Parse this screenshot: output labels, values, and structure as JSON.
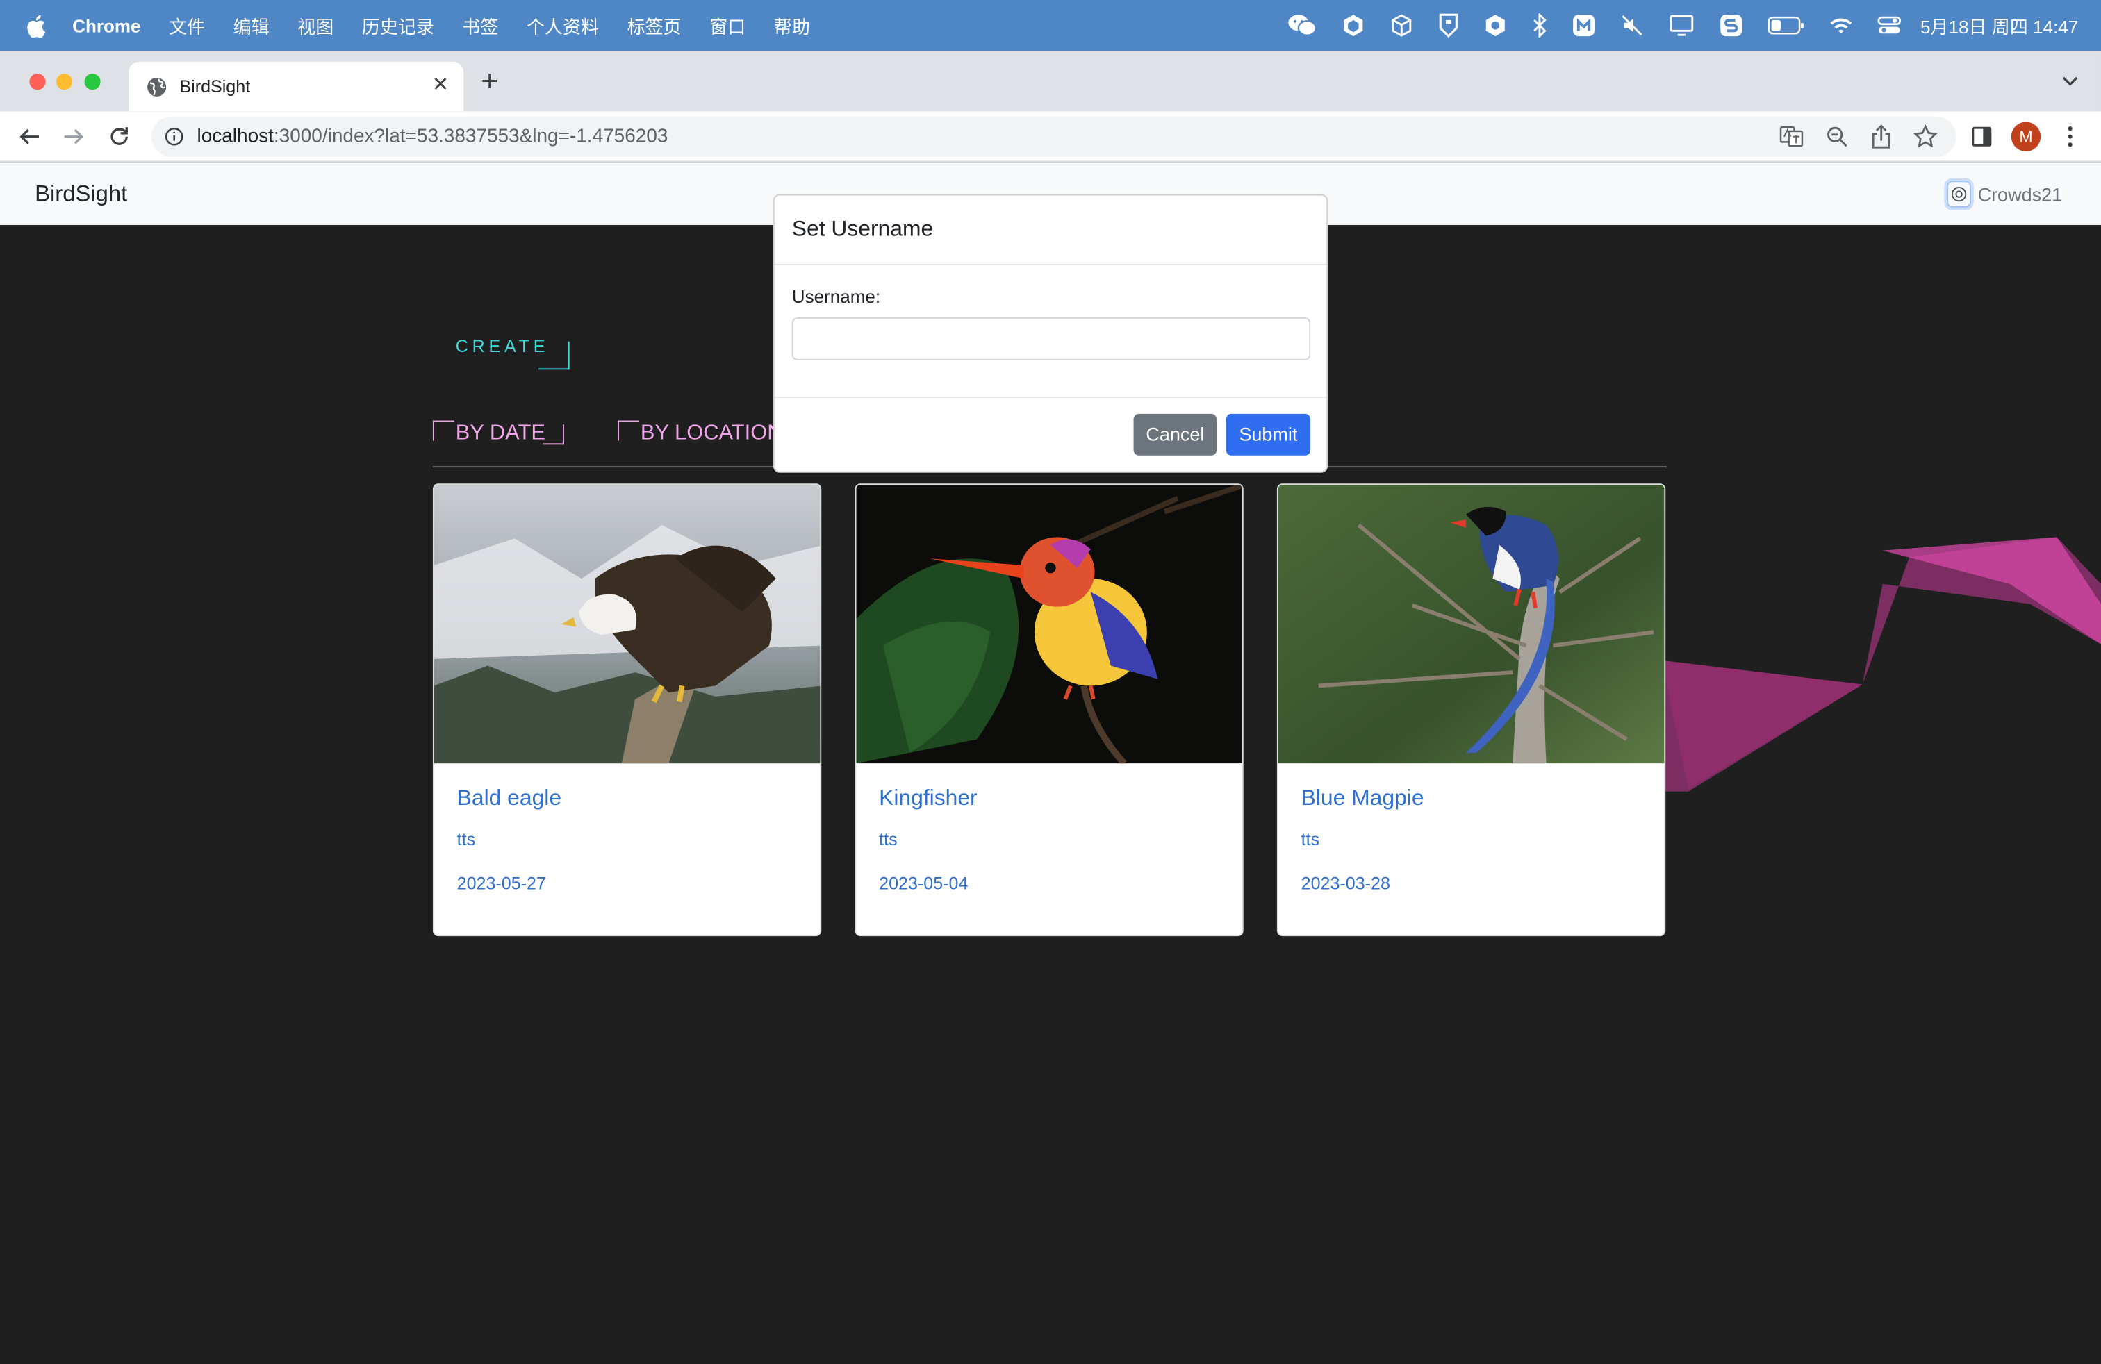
{
  "menubar": {
    "app_name": "Chrome",
    "items": [
      "文件",
      "编辑",
      "视图",
      "历史记录",
      "书签",
      "个人资料",
      "标签页",
      "窗口",
      "帮助"
    ],
    "status_icons": [
      "wechat-icon",
      "cube-icon",
      "cube-outline-icon",
      "shield-app-icon",
      "hexagon-icon",
      "bluetooth-icon",
      "m-app-icon",
      "mute-icon",
      "display-icon",
      "s-app-icon",
      "battery-icon",
      "wifi-icon",
      "control-center-icon"
    ],
    "clock": "5月18日 周四  14:47"
  },
  "browser": {
    "tab_title": "BirdSight",
    "url_host": "localhost",
    "url_rest": ":3000/index?lat=53.3837553&lng=-1.4756203",
    "profile_initial": "M",
    "profile_color": "#c2411d"
  },
  "app": {
    "brand": "BirdSight",
    "username": "Crowds21",
    "create_label": "CREATE",
    "filters": [
      "BY DATE",
      "BY LOCATION"
    ],
    "accent_cyan": "#3bd9d9",
    "accent_pink": "#f0a6e8",
    "link_color": "#2f6fd0"
  },
  "cards": [
    {
      "title": "Bald eagle",
      "user": "tts",
      "date": "2023-05-27"
    },
    {
      "title": "Kingfisher",
      "user": "tts",
      "date": "2023-05-04"
    },
    {
      "title": "Blue Magpie",
      "user": "tts",
      "date": "2023-03-28"
    }
  ],
  "modal": {
    "title": "Set Username",
    "label": "Username:",
    "input_value": "",
    "cancel_label": "Cancel",
    "submit_label": "Submit"
  }
}
